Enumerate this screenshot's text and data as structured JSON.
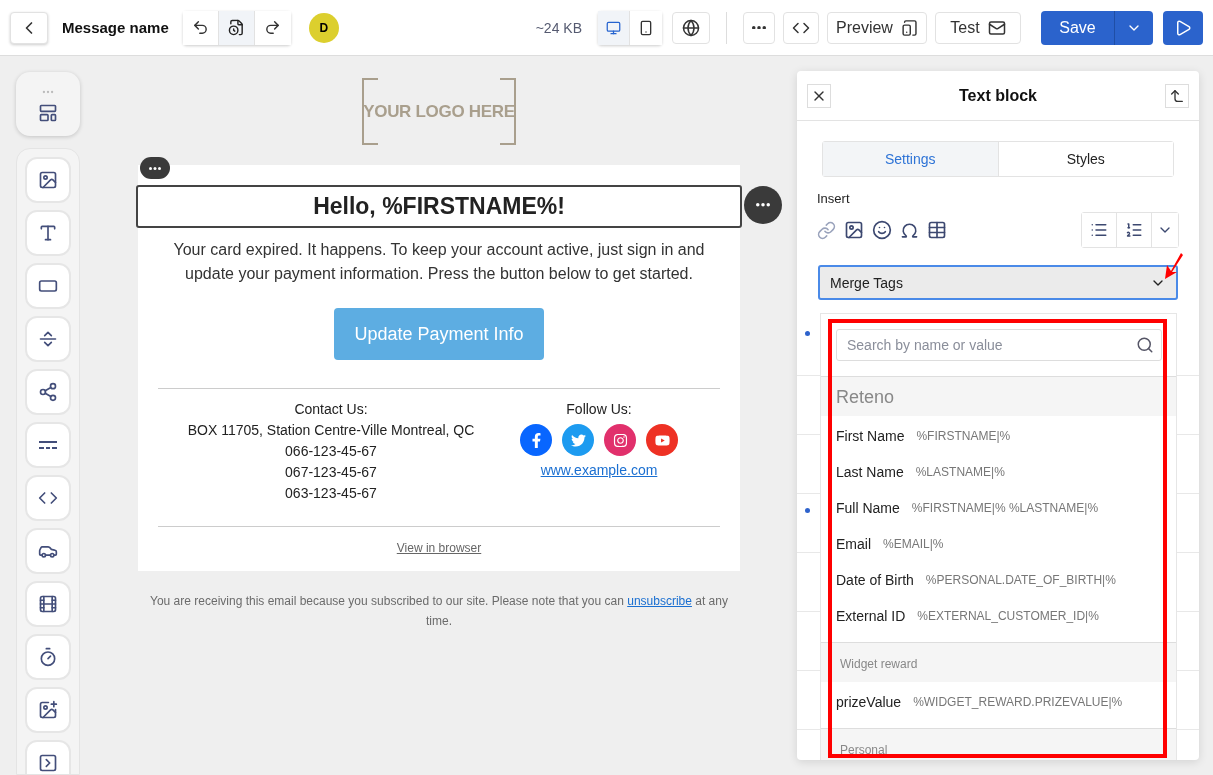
{
  "topbar": {
    "title": "Message name",
    "avatar": "D",
    "size": "~24 KB",
    "devices": [
      {
        "kind": "desktop",
        "selected": true
      },
      {
        "kind": "mobile",
        "selected": false
      }
    ],
    "preview": "Preview",
    "test": "Test",
    "save": "Save"
  },
  "tools": [
    {
      "kind": "image"
    },
    {
      "kind": "text"
    },
    {
      "kind": "button"
    },
    {
      "kind": "spacer"
    },
    {
      "kind": "social"
    },
    {
      "kind": "divider"
    },
    {
      "kind": "html"
    },
    {
      "kind": "menu"
    },
    {
      "kind": "video"
    },
    {
      "kind": "timer"
    },
    {
      "kind": "banner"
    },
    {
      "kind": "terminal"
    }
  ],
  "email": {
    "logo": "YOUR LOGO HERE",
    "heading": "Hello, %FIRSTNAME%!",
    "body": "Your card expired. It happens. To keep your account active, just sign in and update your payment information. Press the button below to get started.",
    "button": "Update Payment Info",
    "contact_title": "Contact Us:",
    "contact_lines": [
      "BOX 11705, Station Centre-Ville Montreal, QC",
      "066-123-45-67",
      "067-123-45-67",
      "063-123-45-67"
    ],
    "follow_title": "Follow Us:",
    "socials": [
      {
        "kind": "facebook",
        "color": "#0866ff"
      },
      {
        "kind": "twitter",
        "color": "#1d9bf0"
      },
      {
        "kind": "instagram",
        "color": "#e1306c"
      },
      {
        "kind": "youtube",
        "color": "#ee3124"
      }
    ],
    "website": "www.example.com",
    "view_in_browser": "View in browser",
    "footer_before": "You are receiving this email because you subscribed to our site. Please note that you can ",
    "footer_link": "unsubscribe",
    "footer_after": " at any time."
  },
  "panel": {
    "title": "Text block",
    "tabs": [
      {
        "label": "Settings",
        "selected": true
      },
      {
        "label": "Styles",
        "selected": false
      }
    ],
    "insert_label": "Insert",
    "merge_select": "Merge Tags",
    "search_placeholder": "Search by name or value",
    "groups": [
      {
        "name": "Reteno",
        "kind": "primary",
        "items": [
          {
            "name": "First Name",
            "value": "%FIRSTNAME|%"
          },
          {
            "name": "Last Name",
            "value": "%LASTNAME|%"
          },
          {
            "name": "Full Name",
            "value": "%FIRSTNAME|% %LASTNAME|%"
          },
          {
            "name": "Email",
            "value": "%EMAIL|%"
          },
          {
            "name": "Date of Birth",
            "value": "%PERSONAL.DATE_OF_BIRTH|%"
          },
          {
            "name": "External ID",
            "value": "%EXTERNAL_CUSTOMER_ID|%"
          }
        ]
      },
      {
        "name": "Widget reward",
        "kind": "secondary",
        "items": [
          {
            "name": "prizeValue",
            "value": "%WIDGET_REWARD.PRIZEVALUE|%"
          }
        ]
      },
      {
        "name": "Personal",
        "kind": "secondary"
      }
    ]
  }
}
